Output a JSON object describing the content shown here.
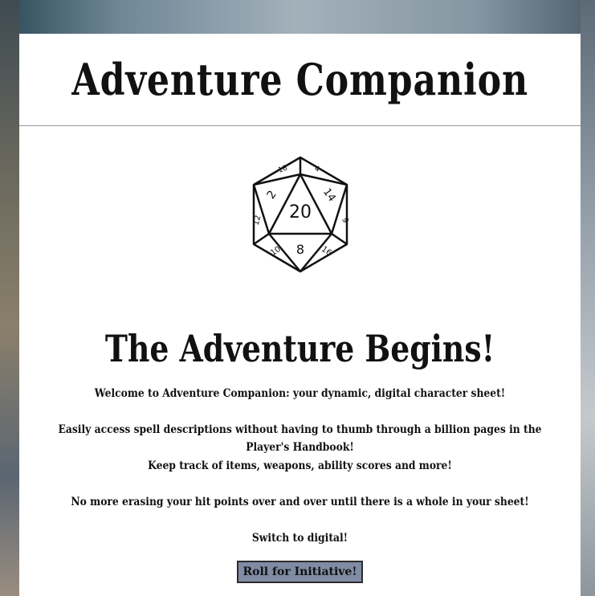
{
  "header": {
    "title": "Adventure Companion"
  },
  "hero": {
    "headline": "The Adventure Begins!",
    "die_faces": [
      "20",
      "2",
      "14",
      "8",
      "18",
      "4",
      "12",
      "9",
      "10",
      "16"
    ]
  },
  "intro_lines": [
    "Welcome to Adventure Companion: your dynamic, digital character sheet!",
    "Easily access spell descriptions without having to thumb through a billion pages in the Player's Handbook!",
    "Keep track of items, weapons, ability scores and more!",
    "No more erasing your hit points over and over until there is a whole in your sheet!",
    "Switch to digital!"
  ],
  "cta": {
    "label": "Roll for Initiative!"
  },
  "colors": {
    "button_bg": "#7f8ca3",
    "card_bg": "#ffffff",
    "text": "#111111"
  }
}
